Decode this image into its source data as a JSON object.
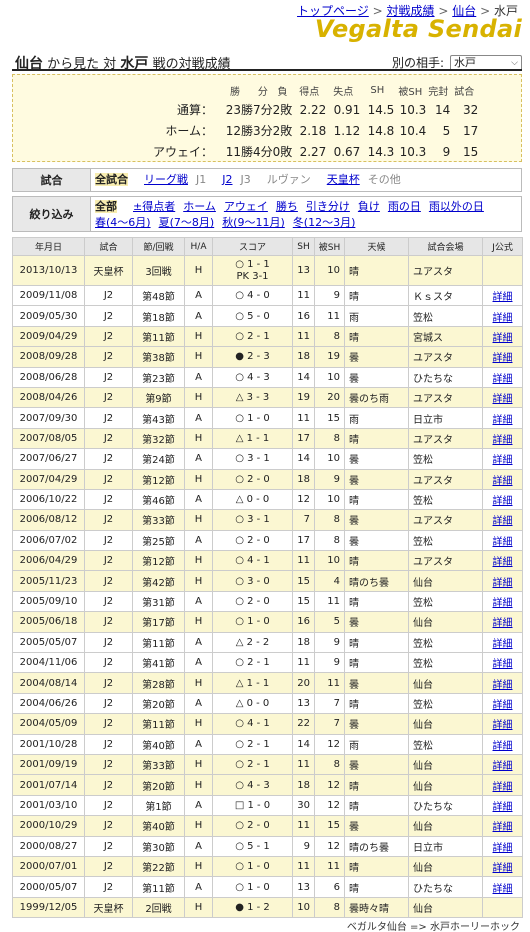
{
  "breadcrumb": {
    "items": [
      "トップページ",
      "対戦成績",
      "仙台",
      "水戸"
    ],
    "sep": ">"
  },
  "logo": "Vegalta Sendai",
  "headline": {
    "team": "仙台",
    "from": "から見た 対",
    "opponent": "水戸",
    "suffix": "戦の対戦成績"
  },
  "opponent_select": {
    "label": "別の相手:",
    "value": "水戸"
  },
  "summary": {
    "headers": [
      "勝",
      "分",
      "負",
      "得点",
      "失点",
      "SH",
      "被SH",
      "完封",
      "試合"
    ],
    "rows": [
      {
        "label": "通算：",
        "values": [
          "23勝",
          "7分",
          "2敗",
          "2.22",
          "0.91",
          "14.5",
          "10.3",
          "14",
          "32"
        ]
      },
      {
        "label": "ホーム：",
        "values": [
          "12勝",
          "3分",
          "2敗",
          "2.18",
          "1.12",
          "14.8",
          "10.4",
          "5",
          "17"
        ]
      },
      {
        "label": "アウェイ：",
        "values": [
          "11勝",
          "4分",
          "0敗",
          "2.27",
          "0.67",
          "14.3",
          "10.3",
          "9",
          "15"
        ]
      }
    ]
  },
  "filter_match": {
    "label": "試合",
    "options": [
      {
        "text": "全試合",
        "state": "selected"
      },
      {
        "text": "リーグ戦",
        "state": "link"
      },
      {
        "text": "J1",
        "state": "gray"
      },
      {
        "text": "J2",
        "state": "link"
      },
      {
        "text": "J3",
        "state": "gray"
      },
      {
        "text": "ルヴァン",
        "state": "gray"
      },
      {
        "text": "天皇杯",
        "state": "link"
      },
      {
        "text": "その他",
        "state": "gray"
      }
    ]
  },
  "filter_narrow": {
    "label": "絞り込み",
    "options": [
      {
        "text": "全部",
        "state": "selected"
      },
      {
        "text": "±得点者",
        "state": "link"
      },
      {
        "text": "ホーム",
        "state": "link"
      },
      {
        "text": "アウェイ",
        "state": "link"
      },
      {
        "text": "勝ち",
        "state": "link"
      },
      {
        "text": "引き分け",
        "state": "link"
      },
      {
        "text": "負け",
        "state": "link"
      },
      {
        "text": "雨の日",
        "state": "link"
      },
      {
        "text": "雨以外の日",
        "state": "link"
      },
      {
        "text": "春(4〜6月)",
        "state": "link"
      },
      {
        "text": "夏(7〜8月)",
        "state": "link"
      },
      {
        "text": "秋(9〜11月)",
        "state": "link"
      },
      {
        "text": "冬(12〜3月)",
        "state": "link"
      }
    ]
  },
  "table": {
    "headers": [
      "年月日",
      "試合",
      "節/回戦",
      "H/A",
      "スコア",
      "SH",
      "被SH",
      "天候",
      "試合会場",
      "J公式"
    ],
    "rows": [
      [
        "2013/10/13",
        "天皇杯",
        "3回戦",
        "H",
        "○ 1 - 1\nPK 3-1",
        "13",
        "10",
        "晴",
        "ユアスタ",
        ""
      ],
      [
        "2009/11/08",
        "J2",
        "第48節",
        "A",
        "○ 4 - 0",
        "11",
        "9",
        "晴",
        "Ｋｓスタ",
        "詳細"
      ],
      [
        "2009/05/30",
        "J2",
        "第18節",
        "A",
        "○ 5 - 0",
        "16",
        "11",
        "雨",
        "笠松",
        "詳細"
      ],
      [
        "2009/04/29",
        "J2",
        "第11節",
        "H",
        "○ 2 - 1",
        "11",
        "8",
        "晴",
        "宮城ス",
        "詳細"
      ],
      [
        "2008/09/28",
        "J2",
        "第38節",
        "H",
        "● 2 - 3",
        "18",
        "19",
        "曇",
        "ユアスタ",
        "詳細"
      ],
      [
        "2008/06/28",
        "J2",
        "第23節",
        "A",
        "○ 4 - 3",
        "14",
        "10",
        "曇",
        "ひたちな",
        "詳細"
      ],
      [
        "2008/04/26",
        "J2",
        "第9節",
        "H",
        "△ 3 - 3",
        "19",
        "20",
        "曇のち雨",
        "ユアスタ",
        "詳細"
      ],
      [
        "2007/09/30",
        "J2",
        "第43節",
        "A",
        "○ 1 - 0",
        "11",
        "15",
        "雨",
        "日立市",
        "詳細"
      ],
      [
        "2007/08/05",
        "J2",
        "第32節",
        "H",
        "△ 1 - 1",
        "17",
        "8",
        "晴",
        "ユアスタ",
        "詳細"
      ],
      [
        "2007/06/27",
        "J2",
        "第24節",
        "A",
        "○ 3 - 1",
        "14",
        "10",
        "曇",
        "笠松",
        "詳細"
      ],
      [
        "2007/04/29",
        "J2",
        "第12節",
        "H",
        "○ 2 - 0",
        "18",
        "9",
        "曇",
        "ユアスタ",
        "詳細"
      ],
      [
        "2006/10/22",
        "J2",
        "第46節",
        "A",
        "△ 0 - 0",
        "12",
        "10",
        "晴",
        "笠松",
        "詳細"
      ],
      [
        "2006/08/12",
        "J2",
        "第33節",
        "H",
        "○ 3 - 1",
        "7",
        "8",
        "曇",
        "ユアスタ",
        "詳細"
      ],
      [
        "2006/07/02",
        "J2",
        "第25節",
        "A",
        "○ 2 - 0",
        "17",
        "8",
        "曇",
        "笠松",
        "詳細"
      ],
      [
        "2006/04/29",
        "J2",
        "第12節",
        "H",
        "○ 4 - 1",
        "11",
        "10",
        "晴",
        "ユアスタ",
        "詳細"
      ],
      [
        "2005/11/23",
        "J2",
        "第42節",
        "H",
        "○ 3 - 0",
        "15",
        "4",
        "晴のち曇",
        "仙台",
        "詳細"
      ],
      [
        "2005/09/10",
        "J2",
        "第31節",
        "A",
        "○ 2 - 0",
        "15",
        "11",
        "晴",
        "笠松",
        "詳細"
      ],
      [
        "2005/06/18",
        "J2",
        "第17節",
        "H",
        "○ 1 - 0",
        "16",
        "5",
        "曇",
        "仙台",
        "詳細"
      ],
      [
        "2005/05/07",
        "J2",
        "第11節",
        "A",
        "△ 2 - 2",
        "18",
        "9",
        "晴",
        "笠松",
        "詳細"
      ],
      [
        "2004/11/06",
        "J2",
        "第41節",
        "A",
        "○ 2 - 1",
        "11",
        "9",
        "晴",
        "笠松",
        "詳細"
      ],
      [
        "2004/08/14",
        "J2",
        "第28節",
        "H",
        "△ 1 - 1",
        "20",
        "11",
        "曇",
        "仙台",
        "詳細"
      ],
      [
        "2004/06/26",
        "J2",
        "第20節",
        "A",
        "△ 0 - 0",
        "13",
        "7",
        "晴",
        "笠松",
        "詳細"
      ],
      [
        "2004/05/09",
        "J2",
        "第11節",
        "H",
        "○ 4 - 1",
        "22",
        "7",
        "曇",
        "仙台",
        "詳細"
      ],
      [
        "2001/10/28",
        "J2",
        "第40節",
        "A",
        "○ 2 - 1",
        "14",
        "12",
        "雨",
        "笠松",
        "詳細"
      ],
      [
        "2001/09/19",
        "J2",
        "第33節",
        "H",
        "○ 2 - 1",
        "11",
        "8",
        "曇",
        "仙台",
        "詳細"
      ],
      [
        "2001/07/14",
        "J2",
        "第20節",
        "H",
        "○ 4 - 3",
        "18",
        "12",
        "晴",
        "仙台",
        "詳細"
      ],
      [
        "2001/03/10",
        "J2",
        "第1節",
        "A",
        "□ 1 - 0",
        "30",
        "12",
        "晴",
        "ひたちな",
        "詳細"
      ],
      [
        "2000/10/29",
        "J2",
        "第40節",
        "H",
        "○ 2 - 0",
        "11",
        "15",
        "曇",
        "仙台",
        "詳細"
      ],
      [
        "2000/08/27",
        "J2",
        "第30節",
        "A",
        "○ 5 - 1",
        "9",
        "12",
        "晴のち曇",
        "日立市",
        "詳細"
      ],
      [
        "2000/07/01",
        "J2",
        "第22節",
        "H",
        "○ 1 - 0",
        "11",
        "11",
        "晴",
        "仙台",
        "詳細"
      ],
      [
        "2000/05/07",
        "J2",
        "第11節",
        "A",
        "○ 1 - 0",
        "13",
        "6",
        "晴",
        "ひたちな",
        "詳細"
      ],
      [
        "1999/12/05",
        "天皇杯",
        "2回戦",
        "H",
        "● 1 - 2",
        "10",
        "8",
        "曇時々晴",
        "仙台",
        ""
      ]
    ]
  },
  "footer": "ベガルタ仙台 => 水戸ホーリーホック"
}
